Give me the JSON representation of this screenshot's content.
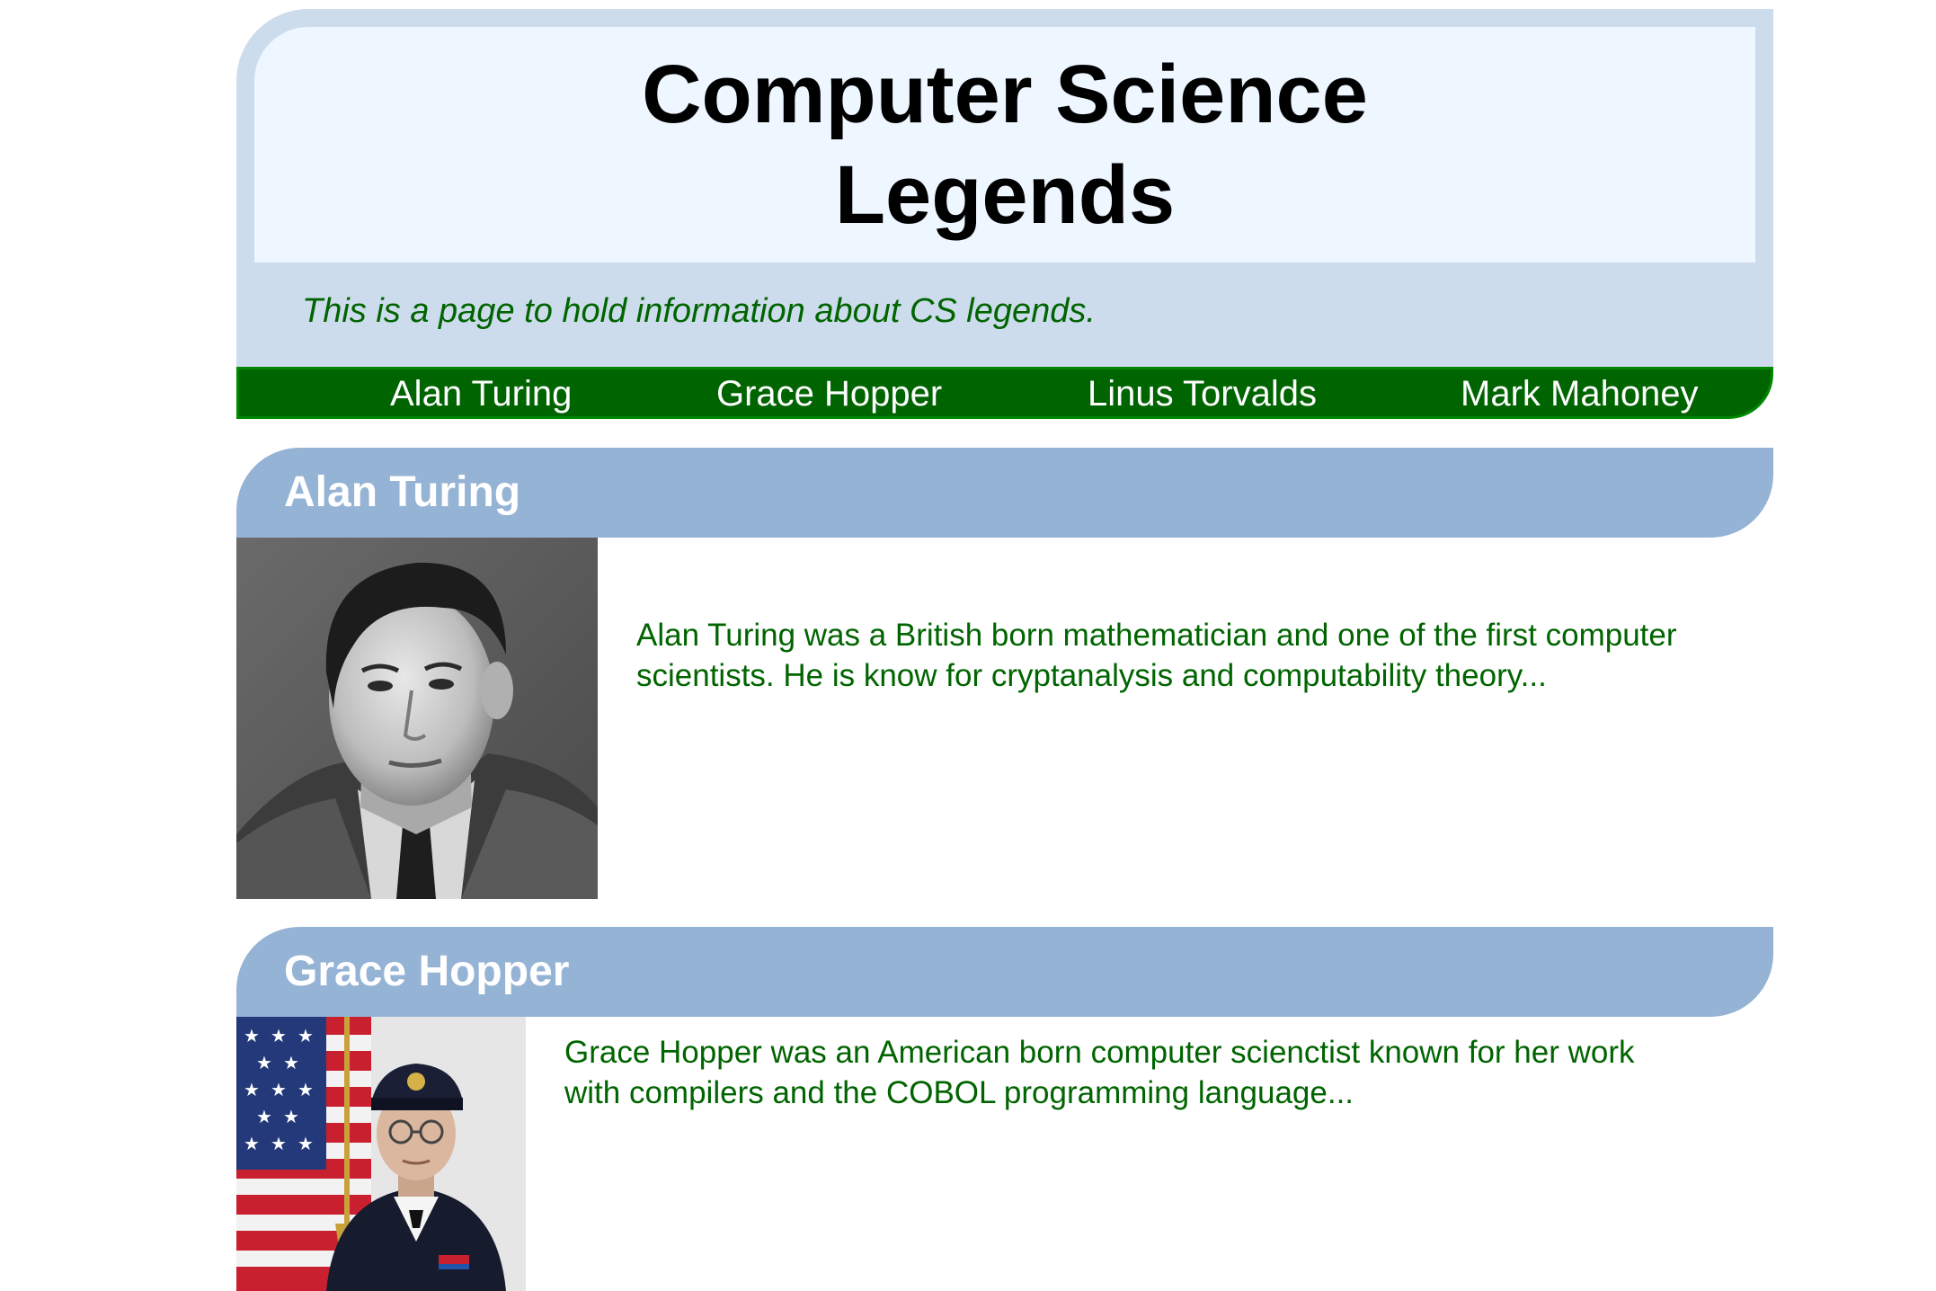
{
  "header": {
    "title_line1": "Computer Science",
    "title_line2": "Legends",
    "tagline": "This is a page to hold information about CS legends."
  },
  "nav": {
    "items": [
      {
        "label": "Alan Turing"
      },
      {
        "label": "Grace Hopper"
      },
      {
        "label": "Linus Torvalds"
      },
      {
        "label": "Mark Mahoney"
      }
    ]
  },
  "sections": [
    {
      "name": "Alan Turing",
      "bio": "Alan Turing was a British born mathematician and one of the first computer scientists. He is know for cryptanalysis and computability theory..."
    },
    {
      "name": "Grace Hopper",
      "bio": "Grace Hopper was an American born computer scienctist known for her work with compilers and the COBOL programming language..."
    }
  ],
  "colors": {
    "header_bg": "#cddcec",
    "title_box_bg": "#eef6ff",
    "nav_bg": "#006400",
    "section_header_bg": "#95b3d5",
    "text_green": "#006400"
  }
}
